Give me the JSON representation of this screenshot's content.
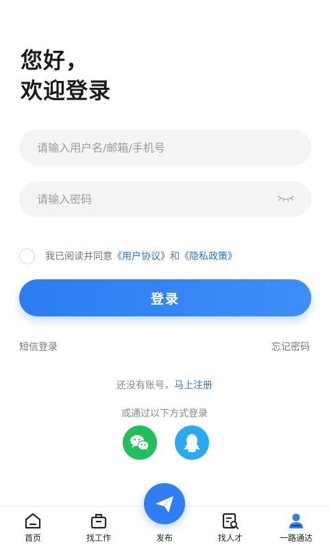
{
  "greeting": {
    "line1": "您好，",
    "line2": "欢迎登录"
  },
  "form": {
    "username_placeholder": "请输入用户名/邮箱/手机号",
    "username_value": "",
    "password_placeholder": "请输入密码",
    "password_value": ""
  },
  "agreement": {
    "prefix": "我已阅读并同意",
    "user_agreement": "《用户协议》",
    "and": "和",
    "privacy_policy": "《隐私政策》",
    "checked": false
  },
  "login_button": "登录",
  "links": {
    "sms_login": "短信登录",
    "forgot_password": "忘记密码"
  },
  "register": {
    "prompt": "还没有账号，",
    "action": "马上注册"
  },
  "third_party": {
    "title": "或通过以下方式登录",
    "options": [
      "wechat-icon",
      "qq-icon"
    ]
  },
  "tabbar": {
    "items": [
      {
        "label": "首页",
        "icon": "home-icon"
      },
      {
        "label": "找工作",
        "icon": "briefcase-icon"
      },
      {
        "label": "发布",
        "icon": "paper-plane-icon"
      },
      {
        "label": "找人才",
        "icon": "resume-search-icon"
      },
      {
        "label": "一路通达",
        "icon": "user-profile-icon"
      }
    ]
  },
  "colors": {
    "accent": "#2c7df2",
    "wechat": "#1fc15a",
    "qq": "#2aa9f0",
    "field_bg": "#f3f4f6"
  }
}
